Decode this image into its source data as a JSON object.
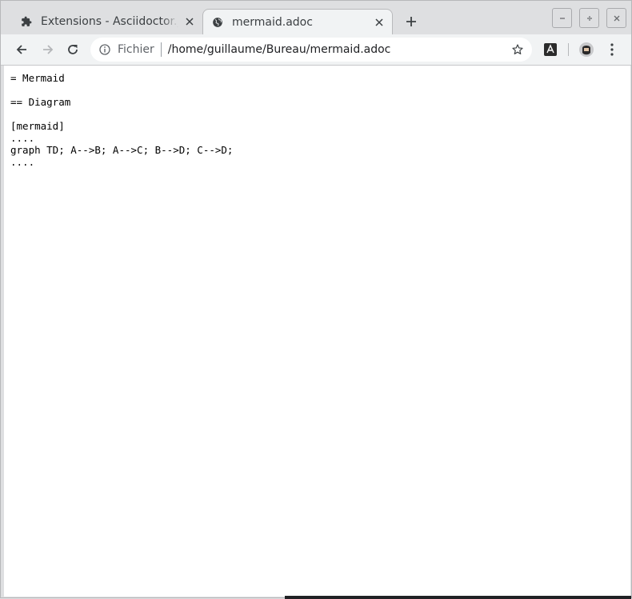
{
  "tabs": [
    {
      "title": "Extensions - Asciidoctor.js",
      "icon": "puzzle-icon",
      "active": false
    },
    {
      "title": "mermaid.adoc",
      "icon": "globe-icon",
      "active": true
    }
  ],
  "window_controls": {
    "minimize": "–",
    "maximize": "+",
    "close": "×"
  },
  "toolbar": {
    "chip": "Fichier",
    "url": "/home/guillaume/Bureau/mermaid.adoc"
  },
  "document": {
    "lines": [
      "= Mermaid",
      "",
      "== Diagram",
      "",
      "[mermaid]",
      "....",
      "graph TD; A-->B; A-->C; B-->D; C-->D;",
      "...."
    ]
  },
  "colors": {
    "frame": "#dedfe1",
    "toolbar": "#f1f3f4",
    "page": "#ffffff",
    "text": "#202124"
  }
}
